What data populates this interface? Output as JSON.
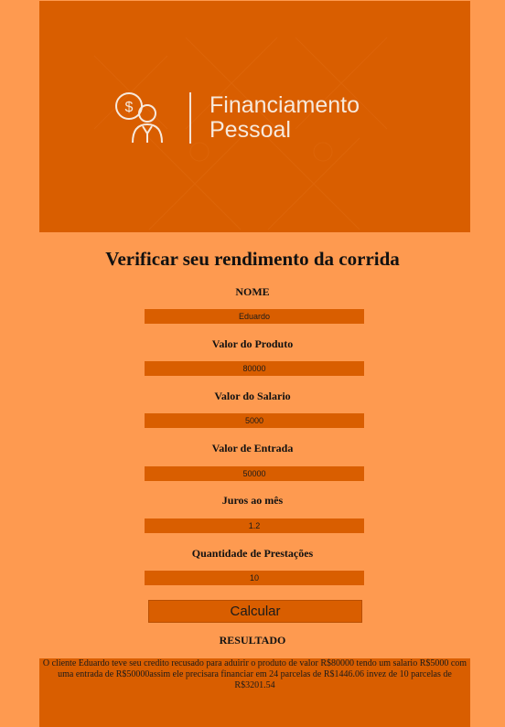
{
  "banner": {
    "title_line1": "Financiamento",
    "title_line2": "Pessoal",
    "icon": "person-dollar-icon"
  },
  "page_title": "Verificar seu rendimento da corrida",
  "fields": [
    {
      "label": "NOME",
      "value": "Eduardo"
    },
    {
      "label": "Valor do Produto",
      "value": "80000"
    },
    {
      "label": "Valor do Salario",
      "value": "5000"
    },
    {
      "label": "Valor de Entrada",
      "value": "50000"
    },
    {
      "label": "Juros ao mês",
      "value": "1.2"
    },
    {
      "label": "Quantidade de Prestações",
      "value": "10"
    }
  ],
  "calculate_label": "Calcular",
  "result": {
    "label": "RESULTADO",
    "text": "O cliente Eduardo teve seu credito recusado para aduirir o produto de valor R$80000 tendo um salario R$5000 com uma entrada de R$50000assim ele precisara financiar em 24 parcelas de R$1446.06 invez de 10 parcelas de R$3201.54"
  },
  "colors": {
    "page_background": "#fe9a50",
    "accent": "#d95e00"
  }
}
